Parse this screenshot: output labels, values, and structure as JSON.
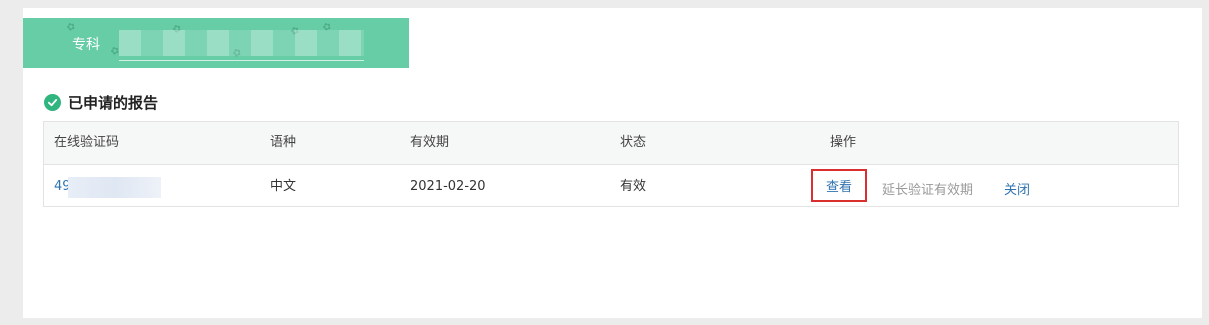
{
  "banner": {
    "level": "专科"
  },
  "section": {
    "title": "已申请的报告"
  },
  "table": {
    "headers": [
      "在线验证码",
      "语种",
      "有效期",
      "状态",
      "操作"
    ],
    "rows": [
      {
        "code_visible": "49",
        "language": "中文",
        "expiry": "2021-02-20",
        "status": "有效",
        "actions": {
          "view": "查看",
          "extend": "延长验证有效期",
          "close": "关闭"
        }
      }
    ]
  },
  "colors": {
    "banner": "#66cda7",
    "accent_green": "#2fb57d",
    "link": "#2f73b1",
    "highlight_border": "#d9302f"
  }
}
